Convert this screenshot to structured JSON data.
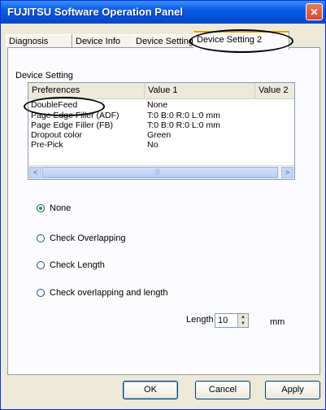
{
  "window": {
    "title": "FUJITSU Software Operation Panel",
    "close_glyph": "✕",
    "titlebar_color": "#0b5de4"
  },
  "tabs": [
    {
      "label": "Diagnosis"
    },
    {
      "label": "Device Info"
    },
    {
      "label": "Device Setting"
    },
    {
      "label": "Device Setting 2",
      "active": true
    }
  ],
  "group": {
    "label": "Device Setting"
  },
  "listview": {
    "columns": [
      "Preferences",
      "Value 1",
      "Value 2"
    ],
    "rows": [
      {
        "preference": "DoubleFeed",
        "value1": "None"
      },
      {
        "preference": "Page Edge Filler (ADF)",
        "value1": "T:0  B:0  R:0  L:0 mm"
      },
      {
        "preference": "Page Edge Filler (FB)",
        "value1": "T:0  B:0  R:0  L:0 mm"
      },
      {
        "preference": "Dropout color",
        "value1": "Green"
      },
      {
        "preference": "Pre-Pick",
        "value1": "No"
      }
    ],
    "scroll_left_glyph": "<",
    "scroll_right_glyph": ">",
    "scroll_thumb_glyph": "|||"
  },
  "options": {
    "selected": "None",
    "items": [
      {
        "label": "None",
        "checked": true
      },
      {
        "label": "Check Overlapping",
        "checked": false
      },
      {
        "label": "Check Length",
        "checked": false
      },
      {
        "label": "Check overlapping and length",
        "checked": false
      }
    ]
  },
  "length": {
    "label": "Length",
    "value": "10",
    "unit": "mm"
  },
  "buttons": {
    "ok": "OK",
    "cancel": "Cancel",
    "apply": "Apply"
  }
}
